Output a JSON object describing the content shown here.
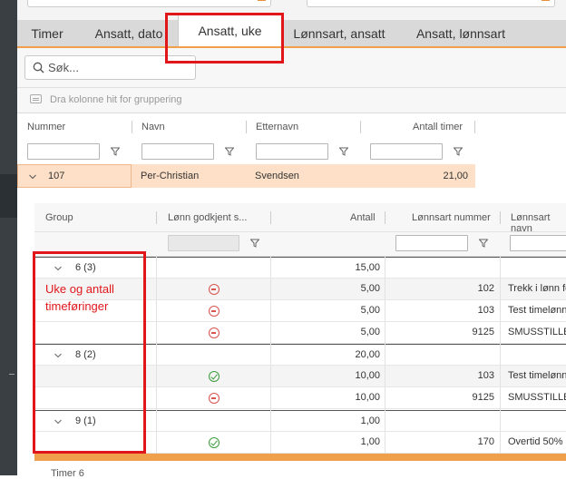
{
  "tabs": [
    {
      "label": "Timer"
    },
    {
      "label": "Ansatt, dato"
    },
    {
      "label": "Ansatt, uke"
    },
    {
      "label": "Lønnsart, ansatt"
    },
    {
      "label": "Ansatt, lønnsart"
    }
  ],
  "search": {
    "placeholder": "Søk..."
  },
  "group_hint": "Dra kolonne hit for gruppering",
  "master": {
    "columns": [
      "Nummer",
      "Navn",
      "Etternavn",
      "Antall timer"
    ],
    "row": {
      "nummer": "107",
      "navn": "Per-Christian",
      "etternavn": "Svendsen",
      "antall": "21,00"
    }
  },
  "detail": {
    "columns": [
      "Group",
      "Lønn godkjent s...",
      "Antall",
      "Lønnsart nummer",
      "Lønnsart navn"
    ],
    "groups": [
      {
        "label": "6 (3)",
        "antall": "15,00",
        "rows": [
          {
            "status": "red",
            "antall": "5,00",
            "nummer": "102",
            "navn": "Trekk i lønn fo"
          },
          {
            "status": "red",
            "antall": "5,00",
            "nummer": "103",
            "navn": "Test timelønn"
          },
          {
            "status": "red",
            "antall": "5,00",
            "nummer": "9125",
            "navn": "SMUSSTILLEGG"
          }
        ]
      },
      {
        "label": "8 (2)",
        "antall": "20,00",
        "rows": [
          {
            "status": "green",
            "antall": "10,00",
            "nummer": "103",
            "navn": "Test timelønn"
          },
          {
            "status": "red",
            "antall": "10,00",
            "nummer": "9125",
            "navn": "SMUSSTILLEGG"
          }
        ]
      },
      {
        "label": "9 (1)",
        "antall": "1,00",
        "rows": [
          {
            "status": "green",
            "antall": "1,00",
            "nummer": "170",
            "navn": "Overtid 50%"
          }
        ]
      }
    ]
  },
  "footer": {
    "label": "Timer",
    "value": "6"
  },
  "annotation": {
    "line1": "Uke og antall",
    "line2": "timeføringer"
  },
  "colors": {
    "accent": "#f0a04b",
    "annotation": "#e0161b",
    "selected_row": "#fde0c7",
    "ok": "#3c9b3c",
    "not_ok": "#d9534f"
  }
}
